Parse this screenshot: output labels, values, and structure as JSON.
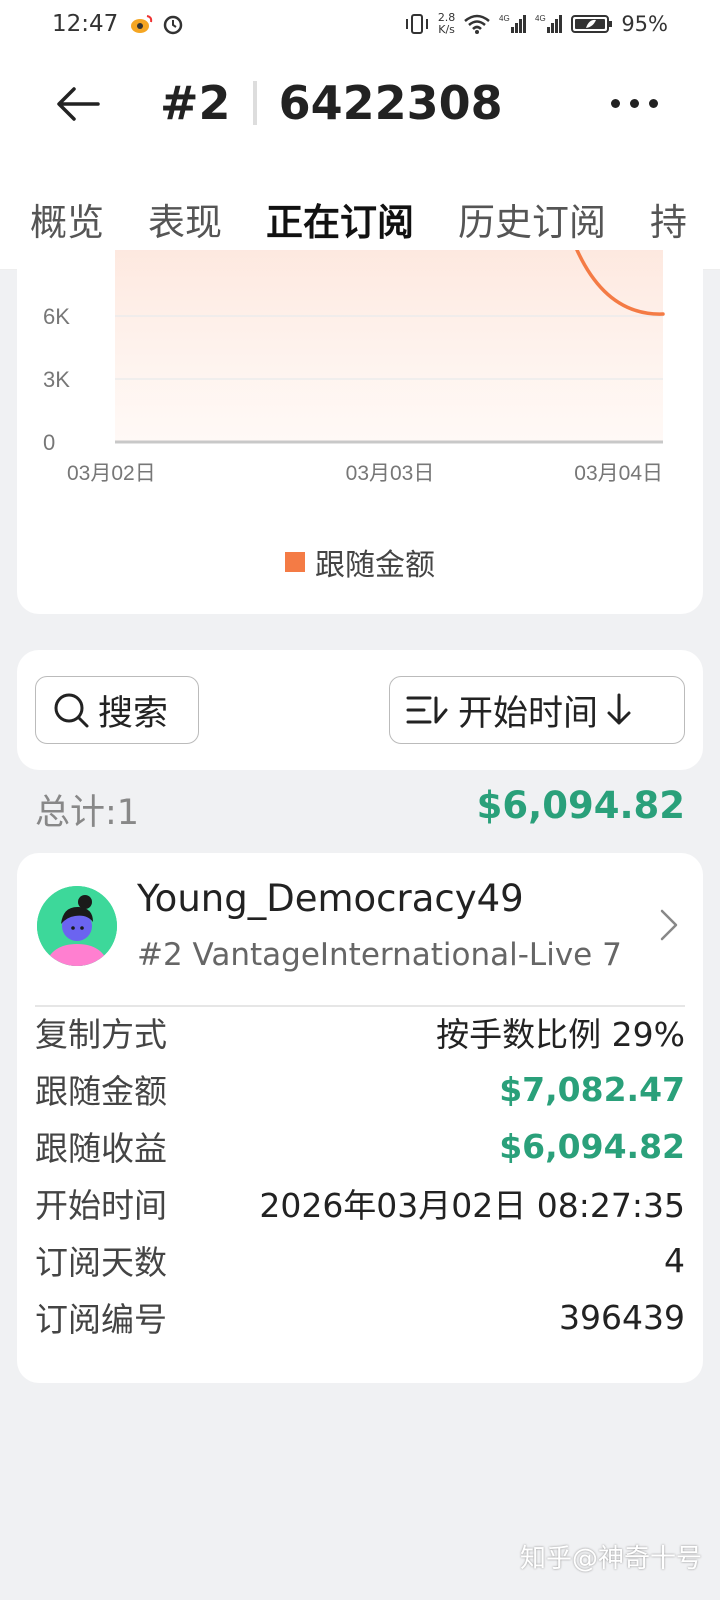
{
  "status": {
    "time": "12:47",
    "net_speed_top": "2.8",
    "net_speed_bottom": "K/s",
    "signal_label_1": "4G",
    "signal_label_2": "4G",
    "battery": "95%"
  },
  "header": {
    "rank": "#2",
    "account": "6422308"
  },
  "tabs": [
    {
      "label": "概览"
    },
    {
      "label": "表现"
    },
    {
      "label": "正在订阅",
      "active": true
    },
    {
      "label": "历史订阅"
    },
    {
      "label": "持"
    }
  ],
  "chart_data": {
    "type": "area",
    "x": [
      "03月02日",
      "03月03日",
      "03月04日"
    ],
    "y_ticks": [
      "0",
      "3K",
      "6K"
    ],
    "series": [
      {
        "name": "跟随金额",
        "color": "#f47b45",
        "points": [
          [
            2.8,
            7082
          ],
          [
            3.0,
            6094
          ]
        ]
      }
    ],
    "ylim": [
      0,
      9000
    ]
  },
  "legend": {
    "label": "跟随金额"
  },
  "search": {
    "label": "搜索"
  },
  "sort": {
    "label": "开始时间"
  },
  "summary": {
    "total_label": "总计:1",
    "total_amount": "$6,094.82"
  },
  "subscription": {
    "name": "Young_Democracy49",
    "strategy": "#2 VantageInternational-Live 7",
    "rows": [
      {
        "key": "复制方式",
        "value": "按手数比例 29%",
        "green": false
      },
      {
        "key": "跟随金额",
        "value": "$7,082.47",
        "green": true
      },
      {
        "key": "跟随收益",
        "value": "$6,094.82",
        "green": true
      },
      {
        "key": "开始时间",
        "value": "2026年03月02日 08:27:35",
        "green": false
      },
      {
        "key": "订阅天数",
        "value": "4",
        "green": false
      },
      {
        "key": "订阅编号",
        "value": "396439",
        "green": false
      }
    ]
  },
  "watermark": "知乎@神奇十号",
  "colors": {
    "accent_green": "#2aa07a",
    "chart_orange": "#f47b45"
  }
}
